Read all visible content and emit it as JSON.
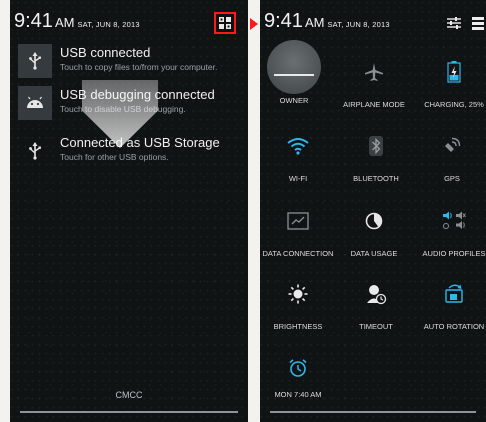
{
  "left": {
    "clock": {
      "time": "9:41",
      "ampm": "AM",
      "date": "SAT, JUN 8, 2013"
    },
    "notifications": [
      {
        "icon": "usb-icon",
        "title": "USB connected",
        "subtitle": "Touch to copy files to/from your computer."
      },
      {
        "icon": "android-debug-icon",
        "title": "USB debugging connected",
        "subtitle": "Touch to disable USB debugging."
      },
      {
        "icon": "usb-icon",
        "title": "Connected as USB Storage",
        "subtitle": "Touch for other USB options."
      }
    ],
    "carrier": "CMCC"
  },
  "right": {
    "clock": {
      "time": "9:41",
      "ampm": "AM",
      "date": "SAT, JUN 8, 2013"
    },
    "tiles": [
      {
        "name": "owner",
        "label": "OWNER"
      },
      {
        "name": "airplane-mode",
        "label": "AIRPLANE MODE"
      },
      {
        "name": "charging",
        "label": "CHARGING, 25%"
      },
      {
        "name": "wifi",
        "label": "WI-FI"
      },
      {
        "name": "bluetooth",
        "label": "BLUETOOTH"
      },
      {
        "name": "gps",
        "label": "GPS"
      },
      {
        "name": "data-connection",
        "label": "DATA CONNECTION"
      },
      {
        "name": "data-usage",
        "label": "DATA USAGE"
      },
      {
        "name": "audio-profiles",
        "label": "AUDIO PROFILES"
      },
      {
        "name": "brightness",
        "label": "BRIGHTNESS"
      },
      {
        "name": "timeout",
        "label": "TIMEOUT"
      },
      {
        "name": "auto-rotation",
        "label": "AUTO ROTATION"
      },
      {
        "name": "alarm",
        "label": "MON 7:40 AM"
      }
    ]
  },
  "colors": {
    "highlight": "#ff1a1a",
    "accent_cyan": "#2fb7e8",
    "panel": "#101314"
  }
}
